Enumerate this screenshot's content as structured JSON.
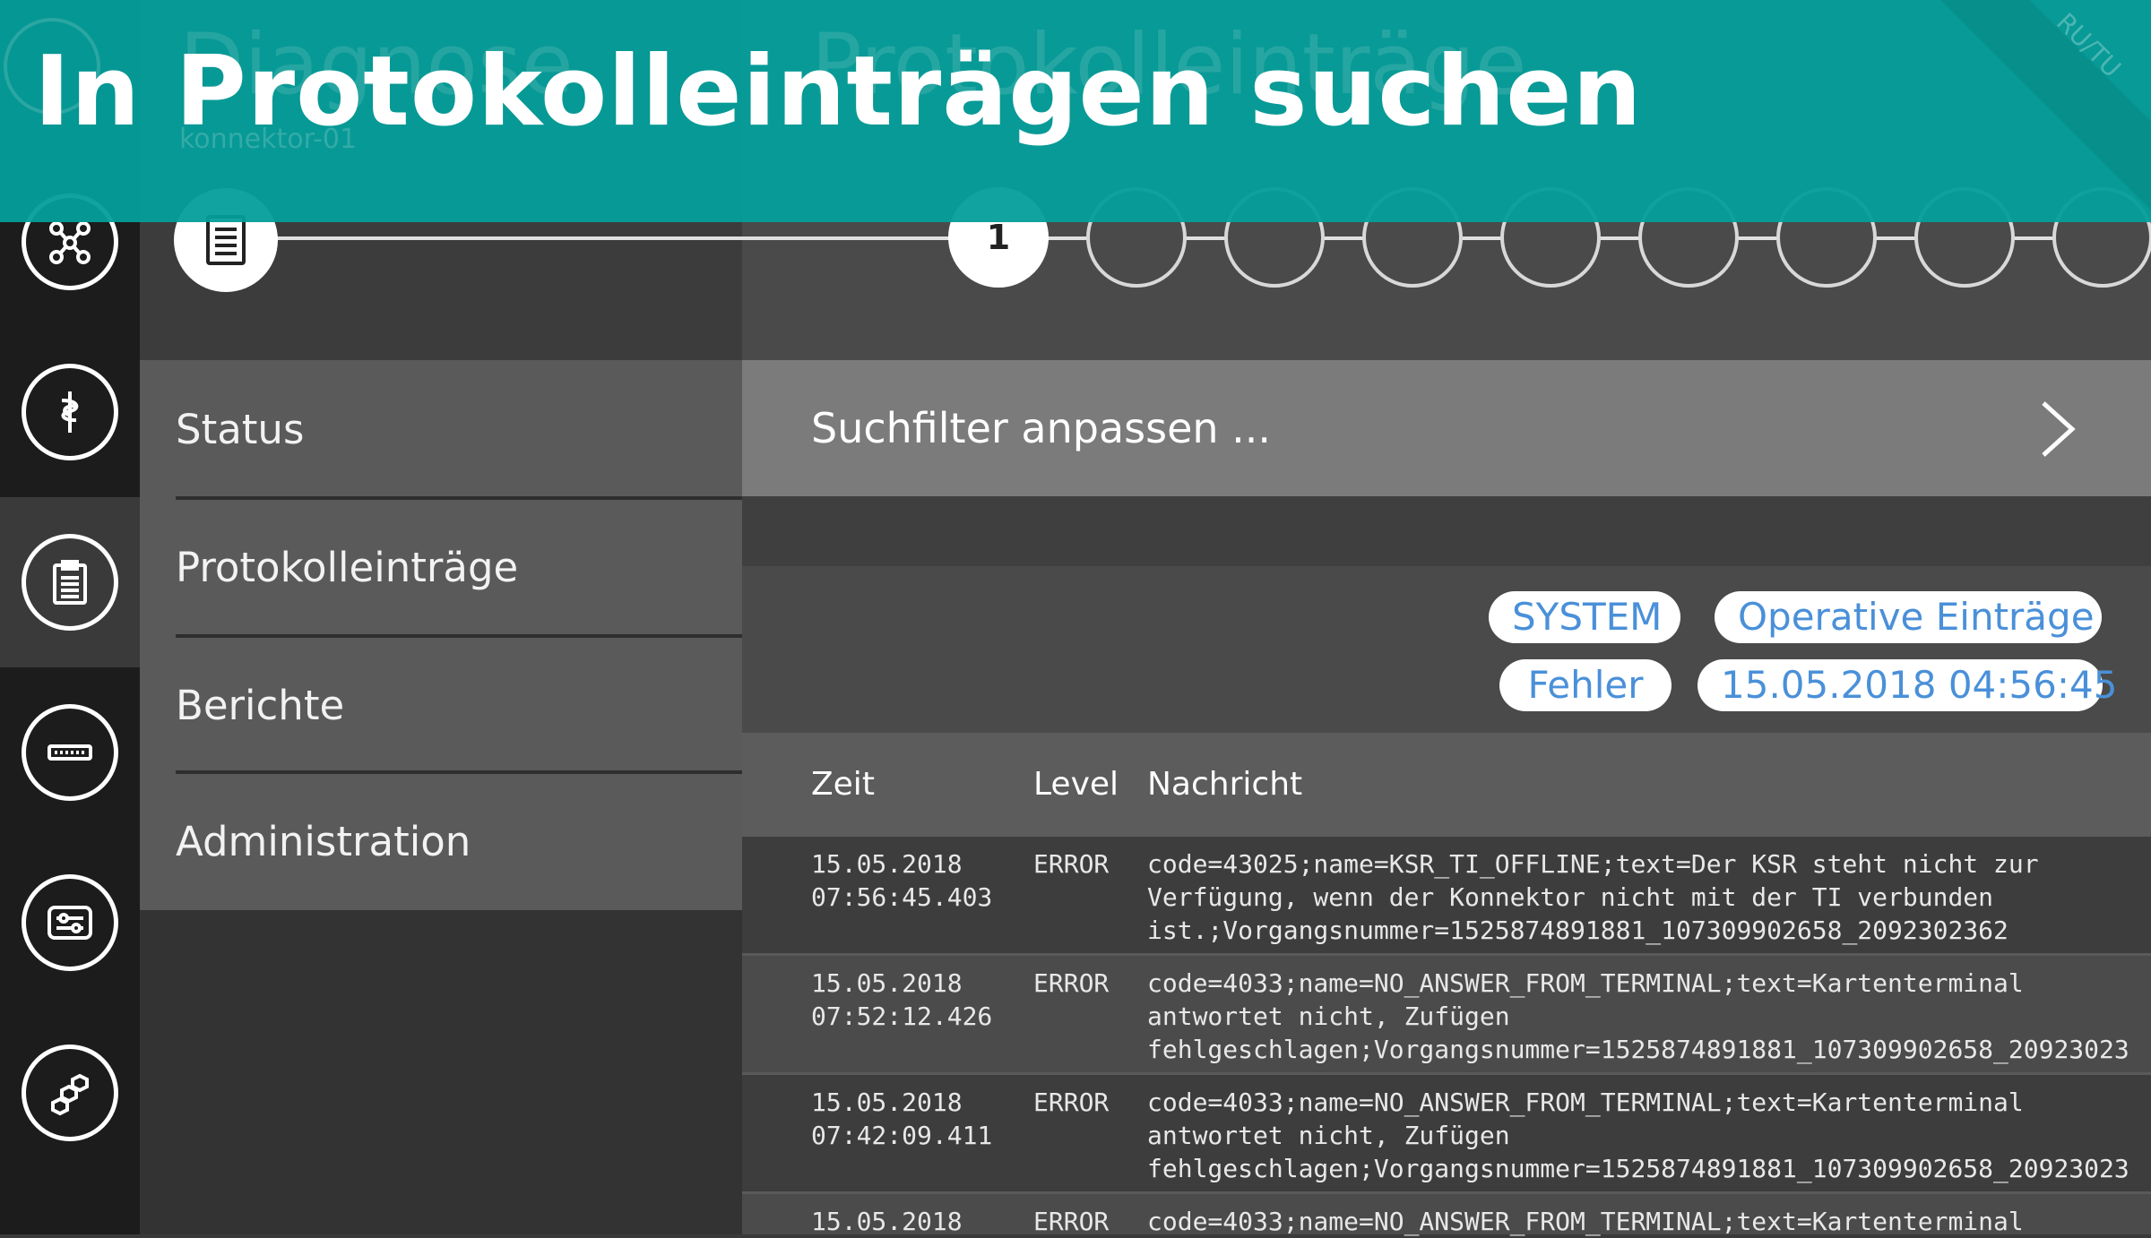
{
  "banner": {
    "title": "In Protokolleinträgen suchen",
    "ghost_title_left": "Diagnose",
    "ghost_title_right": "Protokolleinträge",
    "ghost_subtitle": "konnektor-01",
    "corner_text": "RU/TU"
  },
  "rail": {
    "icons": [
      "network-icon",
      "health-icon",
      "clipboard-icon",
      "connector-device-icon",
      "settings-sliders-icon",
      "modules-icon"
    ],
    "active_index": 2
  },
  "menu": {
    "items": [
      {
        "label": "Status"
      },
      {
        "label": "Protokolleinträge"
      },
      {
        "label": "Berichte"
      },
      {
        "label": "Administration"
      }
    ]
  },
  "stepper": {
    "current_label": "1"
  },
  "filter": {
    "label": "Suchfilter anpassen ..."
  },
  "chips": [
    {
      "label": "SYSTEM"
    },
    {
      "label": "Operative Einträge"
    },
    {
      "label": "Fehler"
    },
    {
      "label": "15.05.2018 04:56:45"
    }
  ],
  "table": {
    "headers": {
      "time": "Zeit",
      "level": "Level",
      "message": "Nachricht"
    },
    "rows": [
      {
        "date": "15.05.2018",
        "time": "07:56:45.403",
        "level": "ERROR",
        "message_lines": [
          "code=43025;name=KSR_TI_OFFLINE;text=Der KSR steht nicht zur",
          "Verfügung, wenn der Konnektor nicht mit der TI verbunden",
          "ist.;Vorgangsnummer=1525874891881_107309902658_2092302362"
        ]
      },
      {
        "date": "15.05.2018",
        "time": "07:52:12.426",
        "level": "ERROR",
        "message_lines": [
          "code=4033;name=NO_ANSWER_FROM_TERMINAL;text=Kartenterminal",
          "antwortet nicht, Zufügen",
          "fehlgeschlagen;Vorgangsnummer=1525874891881_107309902658_20923023"
        ]
      },
      {
        "date": "15.05.2018",
        "time": "07:42:09.411",
        "level": "ERROR",
        "message_lines": [
          "code=4033;name=NO_ANSWER_FROM_TERMINAL;text=Kartenterminal",
          "antwortet nicht, Zufügen",
          "fehlgeschlagen;Vorgangsnummer=1525874891881_107309902658_20923023"
        ]
      },
      {
        "date": "15.05.2018",
        "time": "",
        "level": "ERROR",
        "message_lines": [
          "code=4033;name=NO_ANSWER_FROM_TERMINAL;text=Kartenterminal"
        ]
      }
    ]
  },
  "colors": {
    "banner": "#049e9a",
    "chip_text": "#4a90d9",
    "rail": "#1c1c1c"
  }
}
